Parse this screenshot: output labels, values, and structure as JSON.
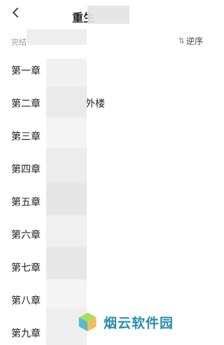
{
  "header": {
    "back_icon": "chevron-left-icon",
    "title_visible": "重生"
  },
  "info_row": {
    "status_visible": "完结",
    "sort_icon": "sort-icon",
    "sort_label": "逆序"
  },
  "chapters": [
    {
      "label": "第一章"
    },
    {
      "label": "第二章",
      "suffix": "外楼"
    },
    {
      "label": "第三章"
    },
    {
      "label": "第四章"
    },
    {
      "label": "第五章"
    },
    {
      "label": "第六章"
    },
    {
      "label": "第七章"
    },
    {
      "label": "第八章"
    },
    {
      "label": "第九章"
    }
  ],
  "watermark": {
    "text": "烟云软件园"
  },
  "colors": {
    "accent": "#2a8ea8",
    "muted_text": "#999999",
    "text": "#222222"
  }
}
